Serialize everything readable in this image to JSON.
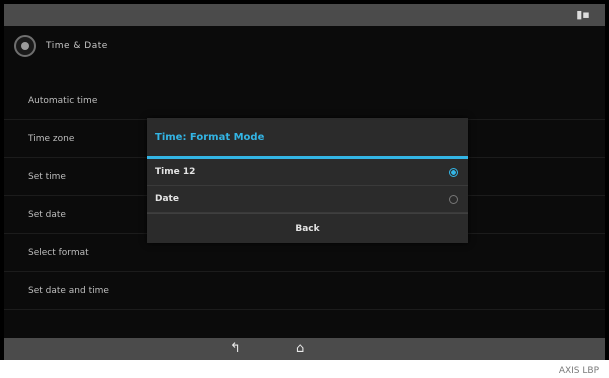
{
  "app": {
    "title": "Time & Date"
  },
  "settings_list": [
    {
      "label": "Automatic time"
    },
    {
      "label": "Time zone"
    },
    {
      "label": "Set time"
    },
    {
      "label": "Set date"
    },
    {
      "label": "Select format"
    },
    {
      "label": "Set date and time"
    }
  ],
  "dialog": {
    "title": "Time: Format Mode",
    "options": [
      {
        "label": "Time 12",
        "selected": true
      },
      {
        "label": "Date",
        "selected": false
      }
    ],
    "button_label": "Back"
  },
  "nav_bar": {
    "back_icon": "back-icon",
    "home_icon": "home-icon"
  },
  "status_bar": {
    "icon": "signal-icon"
  },
  "watermark": {
    "text": "AXIS LBP"
  },
  "colors": {
    "accent": "#33b5e5",
    "dialog_bg": "#2b2b2b",
    "screen_bg": "#0b0b0b",
    "bar_bg": "#4b4b4b"
  }
}
